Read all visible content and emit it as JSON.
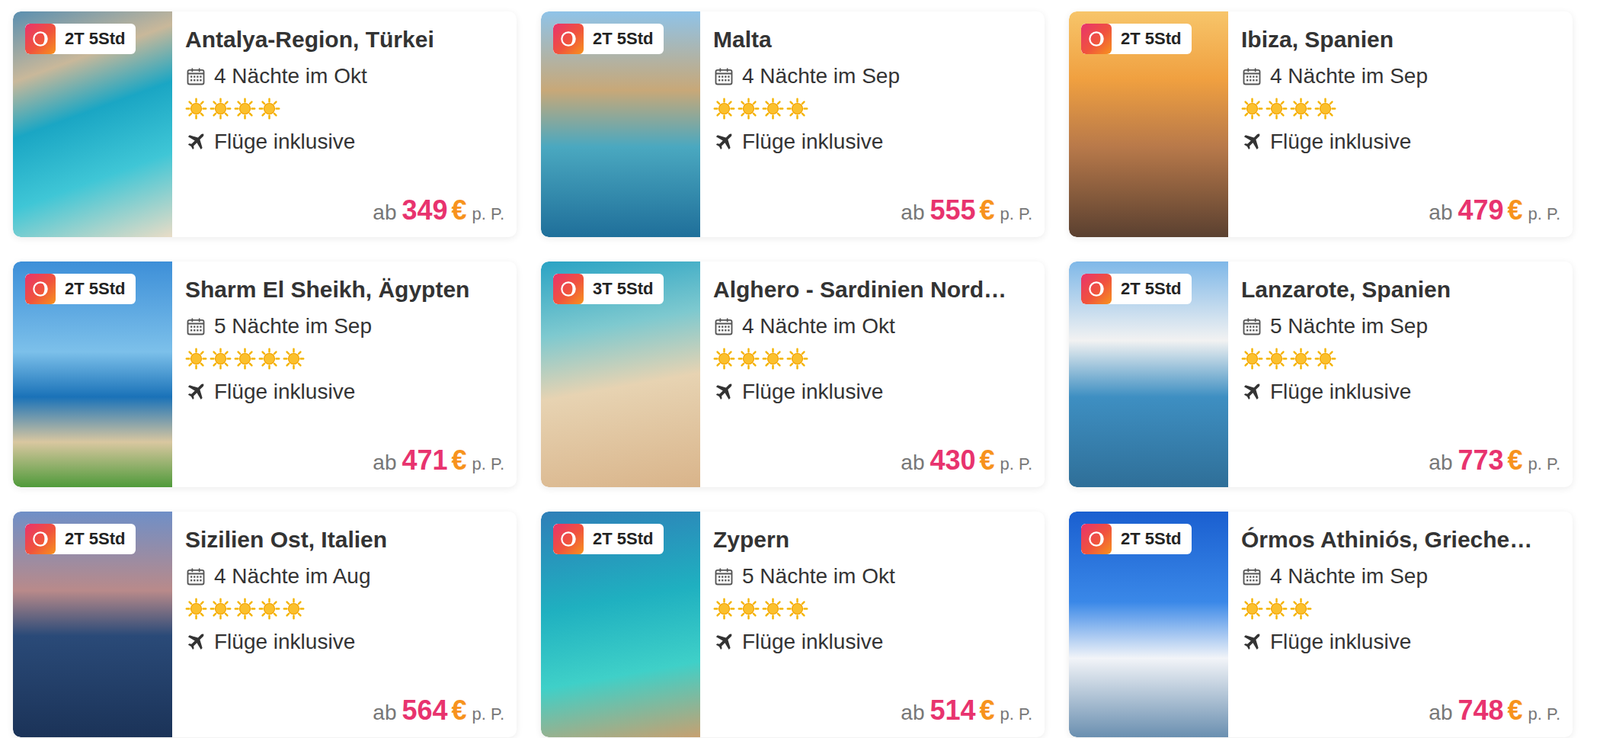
{
  "offers": [
    {
      "duration": "2T 5Std",
      "title": "Antalya-Region, Türkei",
      "nights": "4 Nächte im Okt",
      "stars": 4,
      "flights": "Flüge inklusive",
      "prefix": "ab",
      "price": "349",
      "currency": "€",
      "per": "p. P."
    },
    {
      "duration": "2T 5Std",
      "title": "Malta",
      "nights": "4 Nächte im Sep",
      "stars": 4,
      "flights": "Flüge inklusive",
      "prefix": "ab",
      "price": "555",
      "currency": "€",
      "per": "p. P."
    },
    {
      "duration": "2T 5Std",
      "title": "Ibiza, Spanien",
      "nights": "4 Nächte im Sep",
      "stars": 4,
      "flights": "Flüge inklusive",
      "prefix": "ab",
      "price": "479",
      "currency": "€",
      "per": "p. P."
    },
    {
      "duration": "2T 5Std",
      "title": "Sharm El Sheikh, Ägypten",
      "nights": "5 Nächte im Sep",
      "stars": 5,
      "flights": "Flüge inklusive",
      "prefix": "ab",
      "price": "471",
      "currency": "€",
      "per": "p. P."
    },
    {
      "duration": "3T 5Std",
      "title": "Alghero - Sardinien Nord…",
      "nights": "4 Nächte im Okt",
      "stars": 4,
      "flights": "Flüge inklusive",
      "prefix": "ab",
      "price": "430",
      "currency": "€",
      "per": "p. P."
    },
    {
      "duration": "2T 5Std",
      "title": "Lanzarote, Spanien",
      "nights": "5 Nächte im Sep",
      "stars": 4,
      "flights": "Flüge inklusive",
      "prefix": "ab",
      "price": "773",
      "currency": "€",
      "per": "p. P."
    },
    {
      "duration": "2T 5Std",
      "title": "Sizilien Ost, Italien",
      "nights": "4 Nächte im Aug",
      "stars": 5,
      "flights": "Flüge inklusive",
      "prefix": "ab",
      "price": "564",
      "currency": "€",
      "per": "p. P."
    },
    {
      "duration": "2T 5Std",
      "title": "Zypern",
      "nights": "5 Nächte im Okt",
      "stars": 4,
      "flights": "Flüge inklusive",
      "prefix": "ab",
      "price": "514",
      "currency": "€",
      "per": "p. P."
    },
    {
      "duration": "2T 5Std",
      "title": "Órmos Athiniós, Grieche…",
      "nights": "4 Nächte im Sep",
      "stars": 3,
      "flights": "Flüge inklusive",
      "prefix": "ab",
      "price": "748",
      "currency": "€",
      "per": "p. P."
    }
  ]
}
